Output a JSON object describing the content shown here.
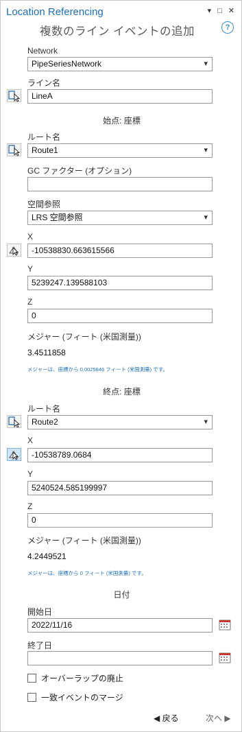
{
  "pane": {
    "title": "Location Referencing",
    "header_icons": [
      "▾",
      "□",
      "✕"
    ],
    "subtitle": "複数のライン イベントの追加",
    "help": "?"
  },
  "network": {
    "label": "Network",
    "value": "PipeSeriesNetwork"
  },
  "line": {
    "label": "ライン名",
    "value": "LineA"
  },
  "start": {
    "section": "始点: 座標",
    "route_label": "ルート名",
    "route_value": "Route1",
    "gc_label": "GC ファクター (オプション)",
    "gc_value": "",
    "sr_label": "空間参照",
    "sr_value": "LRS 空間参照",
    "x_label": "X",
    "x_value": "-10538830.663615566",
    "y_label": "Y",
    "y_value": "5239247.139588103",
    "z_label": "Z",
    "z_value": "0",
    "measure_label": "メジャー (フィート (米国測量))",
    "measure_value": "3.4511858",
    "note": "メジャーは、座標から 0.0025846 フィート (米国測量) です。"
  },
  "end": {
    "section": "終点: 座標",
    "route_label": "ルート名",
    "route_value": "Route2",
    "x_label": "X",
    "x_value": "-10538789.0684",
    "y_label": "Y",
    "y_value": "5240524.585199997",
    "z_label": "Z",
    "z_value": "0",
    "measure_label": "メジャー (フィート (米国測量))",
    "measure_value": "4.2449521",
    "note": "メジャーは、座標から 0 フィート (米国測量) です。"
  },
  "dates": {
    "section": "日付",
    "start_label": "開始日",
    "start_value": "2022/11/16",
    "end_label": "終了日",
    "end_value": ""
  },
  "options": {
    "retire_overlap": "オーバーラップの廃止",
    "merge_coincident": "一致イベントのマージ"
  },
  "nav": {
    "back": "◀ 戻る",
    "next": "次へ ▶"
  }
}
